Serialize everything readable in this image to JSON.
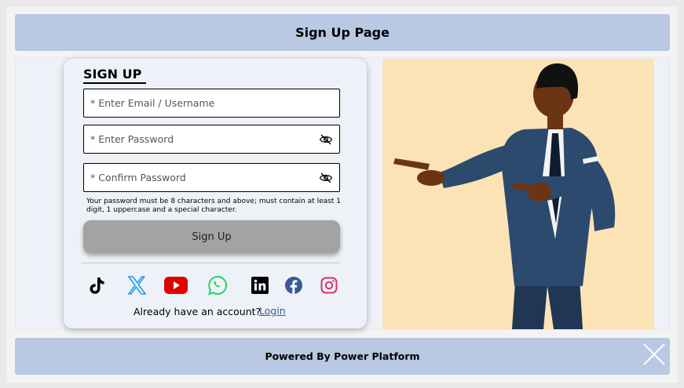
{
  "header": {
    "title": "Sign Up Page"
  },
  "form": {
    "title": "SIGN UP",
    "email_placeholder": "* Enter Email / Username",
    "password_placeholder": "* Enter Password",
    "confirm_placeholder": "* Confirm Password",
    "password_hint": "Your password must be 8 characters and above; must contain at least 1 digit, 1 uppercase and a special character.",
    "signup_label": "Sign Up",
    "account_text": "Already have an account?",
    "login_label": "Login"
  },
  "social_icons": [
    "tiktok-icon",
    "x-icon",
    "youtube-icon",
    "whatsapp-icon",
    "linkedin-icon",
    "facebook-icon",
    "instagram-icon"
  ],
  "colors": {
    "header_bg": "#b9c9e3",
    "button_bg": "#a3a3a3",
    "illustration_bg": "#fbe3b6",
    "link": "#3a5a9c"
  },
  "footer": {
    "text": "Powered By Power Platform"
  }
}
